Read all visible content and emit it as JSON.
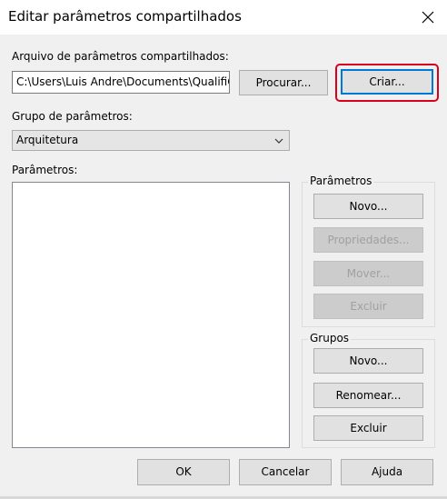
{
  "dialog": {
    "title": "Editar parâmetros compartilhados",
    "close_icon": "close-icon"
  },
  "file_section": {
    "label": "Arquivo de parâmetros compartilhados:",
    "path_value": "C:\\Users\\Luis Andre\\Documents\\QualifiC",
    "browse_label": "Procurar...",
    "create_label": "Criar..."
  },
  "group_section": {
    "label": "Grupo de parâmetros:",
    "selected": "Arquitetura"
  },
  "params_section": {
    "label": "Parâmetros:"
  },
  "params_box": {
    "legend": "Parâmetros",
    "new_label": "Novo...",
    "properties_label": "Propriedades...",
    "move_label": "Mover...",
    "delete_label": "Excluir"
  },
  "groups_box": {
    "legend": "Grupos",
    "new_label": "Novo...",
    "rename_label": "Renomear...",
    "delete_label": "Excluir"
  },
  "footer": {
    "ok_label": "OK",
    "cancel_label": "Cancelar",
    "help_label": "Ajuda"
  },
  "colors": {
    "highlight": "#d9001b",
    "accent": "#0078d7"
  }
}
